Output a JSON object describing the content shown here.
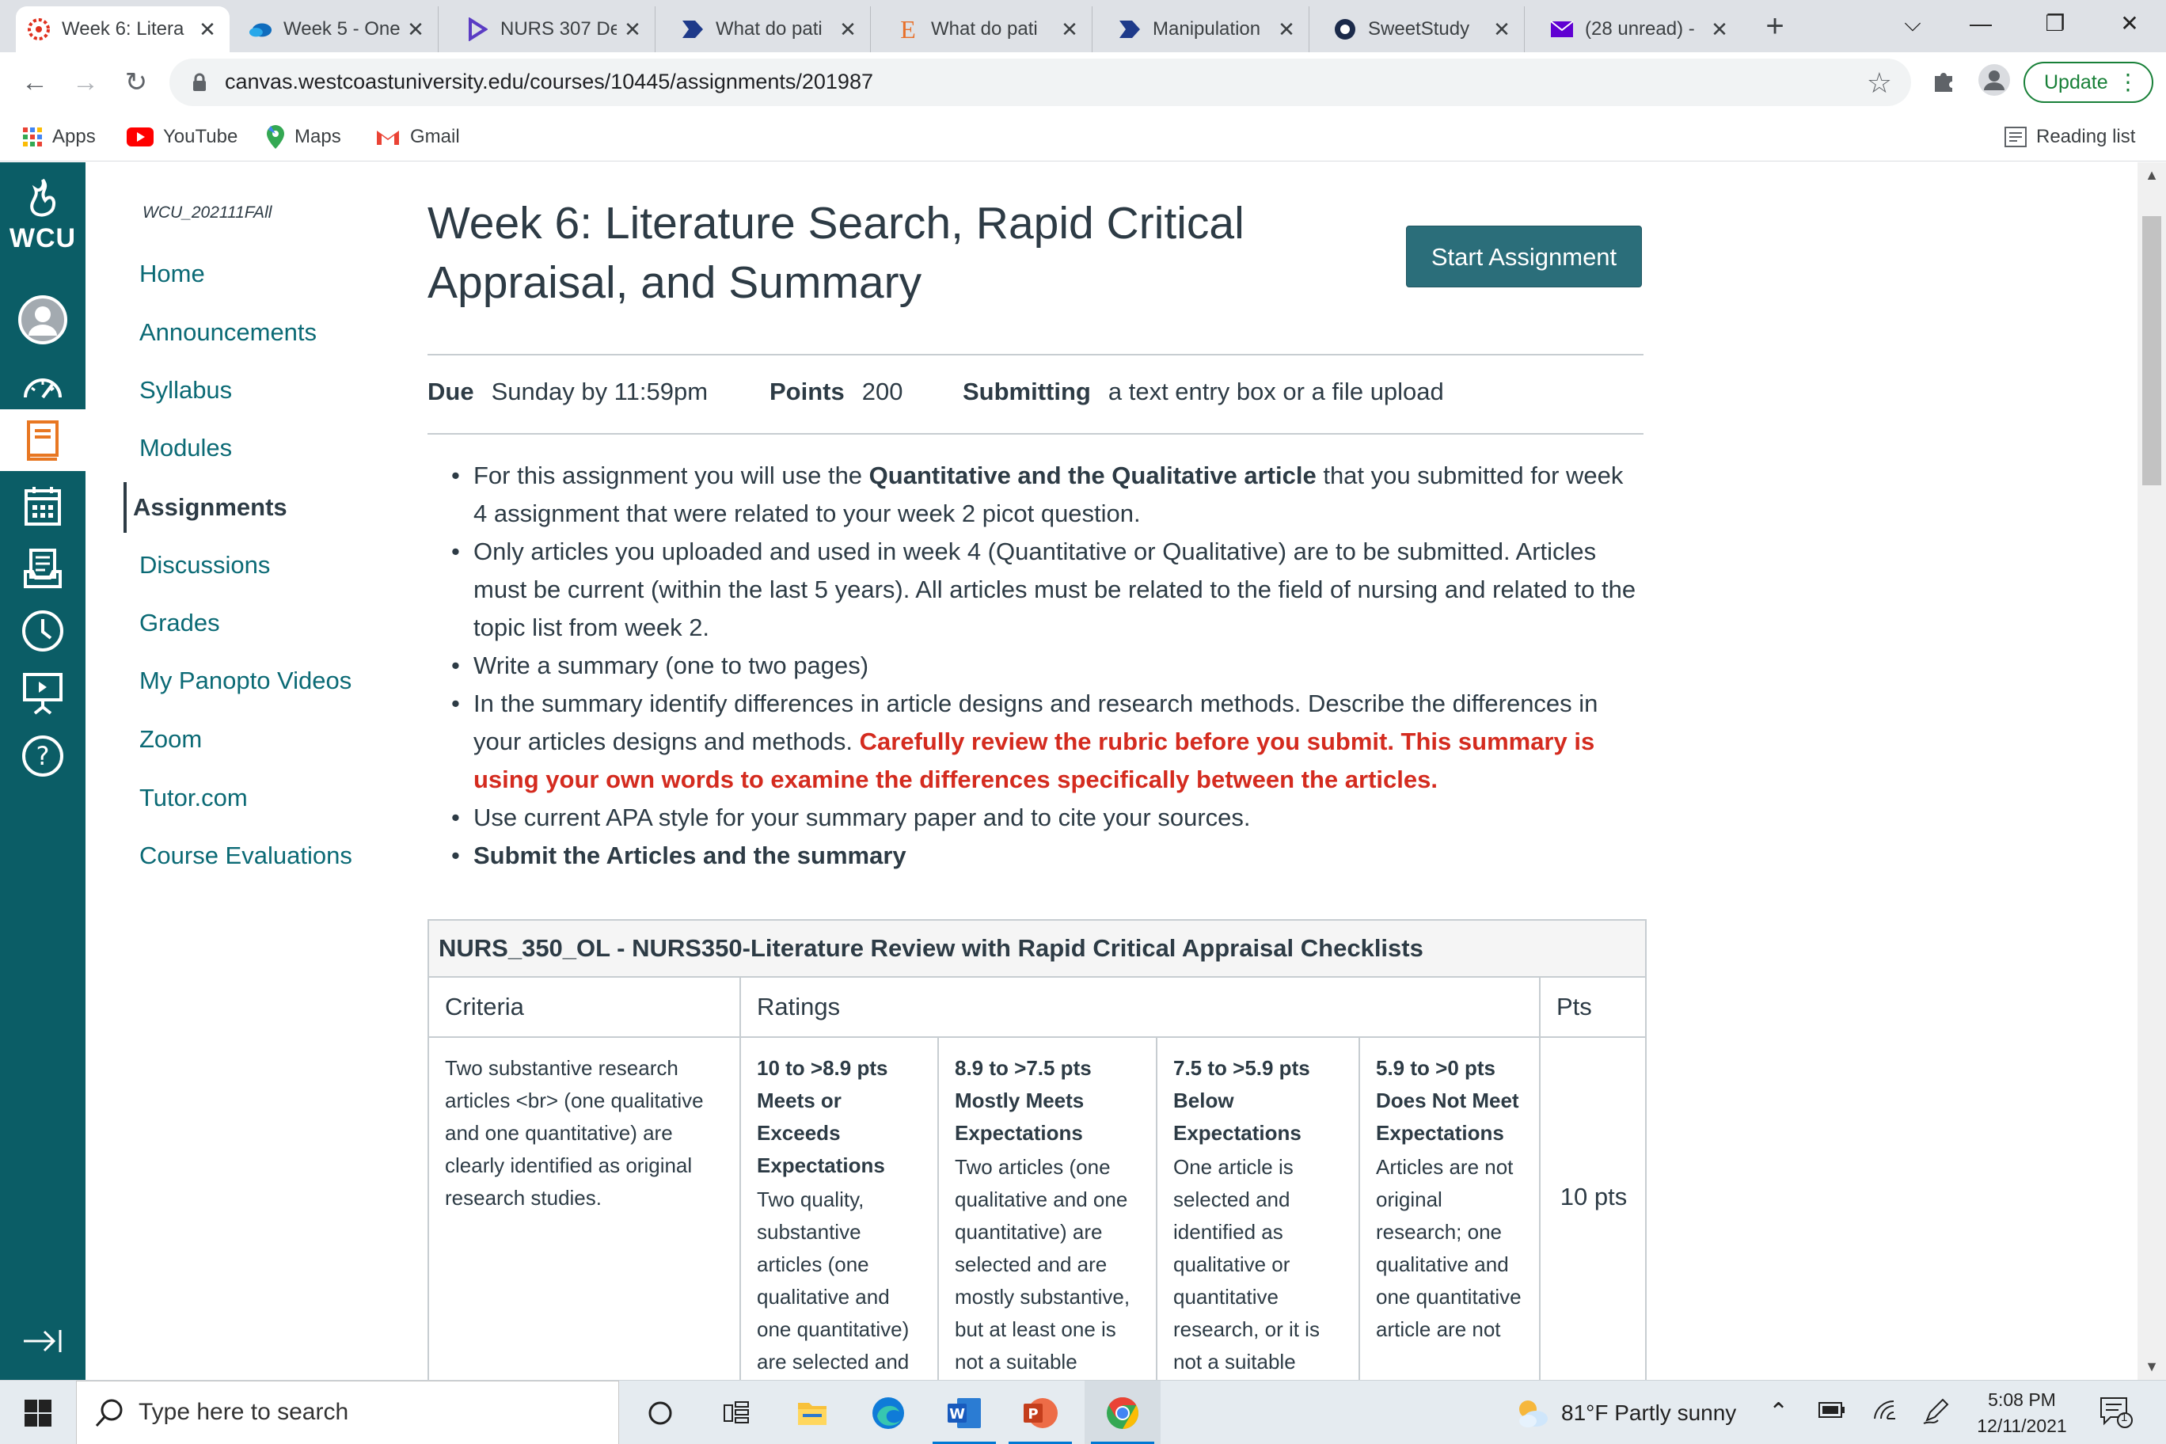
{
  "browser": {
    "tabs": [
      {
        "label": "Week 6: Litera",
        "active": true
      },
      {
        "label": "Week 5 - One"
      },
      {
        "label": "NURS 307 De"
      },
      {
        "label": "What do pati"
      },
      {
        "label": "What do pati"
      },
      {
        "label": "Manipulation"
      },
      {
        "label": "SweetStudy"
      },
      {
        "label": "(28 unread) -"
      }
    ],
    "new_tab": "+",
    "url": "canvas.westcoastuniversity.edu/courses/10445/assignments/201987",
    "update_label": "Update",
    "bookmarks": [
      "Apps",
      "YouTube",
      "Maps",
      "Gmail"
    ],
    "reading_list": "Reading list"
  },
  "brand": {
    "logo_text": "WCU",
    "primary": "#0b5d66",
    "link": "#0b6a75",
    "button": "#2b6e7a",
    "alert": "#d42b1f"
  },
  "course_nav": {
    "course_code": "WCU_202111FAll",
    "items": [
      "Home",
      "Announcements",
      "Syllabus",
      "Modules",
      "Assignments",
      "Discussions",
      "Grades",
      "My Panopto Videos",
      "Zoom",
      "Tutor.com",
      "Course Evaluations"
    ],
    "active": "Assignments"
  },
  "assignment": {
    "title": "Week 6: Literature Search, Rapid Critical Appraisal, and Summary",
    "start_label": "Start Assignment",
    "due_label": "Due",
    "due_value": "Sunday by 11:59pm",
    "points_label": "Points",
    "points_value": "200",
    "submitting_label": "Submitting",
    "submitting_value": "a text entry box or a file upload",
    "bullets": {
      "b1_pre": "For this assignment you will use the ",
      "b1_bold": "Quantitative and the Qualitative article",
      "b1_post": " that you submitted for week 4 assignment that were related to your week 2 picot question.",
      "b2": "Only articles you uploaded and used in week 4 (Quantitative or Qualitative) are to be submitted. Articles must be current (within the last 5 years). All articles must be related to the field of nursing and related to the topic list from week 2.",
      "b3": "Write a summary (one to two pages)",
      "b4_pre": "In the summary identify differences in article designs and research methods. Describe the differences in your articles designs and methods. ",
      "b4_red": "Carefully review the rubric before you submit. This summary is using your own words to examine the differences specifically between the articles.",
      "b5": "Use current APA style for your summary paper and to cite your sources.",
      "b6": "Submit the Articles and the summary"
    }
  },
  "rubric": {
    "title": "NURS_350_OL - NURS350-Literature Review with Rapid Critical Appraisal Checklists",
    "headers": {
      "criteria": "Criteria",
      "ratings": "Ratings",
      "pts": "Pts"
    },
    "row": {
      "criteria": "Two substantive research articles <br> (one qualitative and one quantitative) are clearly identified as original research studies.",
      "ratings": [
        {
          "range": "10 to >8.9 pts",
          "title": "Meets or Exceeds Expectations",
          "desc": "Two quality, substantive articles (one qualitative and one quantitative) are selected and"
        },
        {
          "range": "8.9 to >7.5 pts",
          "title": "Mostly Meets Expectations",
          "desc": "Two articles (one qualitative and one quantitative) are selected and are mostly substantive, but at least one is not a suitable"
        },
        {
          "range": "7.5 to >5.9 pts",
          "title": "Below Expectations",
          "desc": "One article is selected and identified as qualitative or quantitative research, or it is not a suitable"
        },
        {
          "range": "5.9 to >0 pts",
          "title": "Does Not Meet Expectations",
          "desc": "Articles are not original research; one qualitative and one quantitative article are not"
        }
      ],
      "pts": "10 pts"
    }
  },
  "taskbar": {
    "search_placeholder": "Type here to search",
    "weather": "81°F  Partly sunny",
    "time": "5:08 PM",
    "date": "12/11/2021",
    "notification_count": "1"
  }
}
